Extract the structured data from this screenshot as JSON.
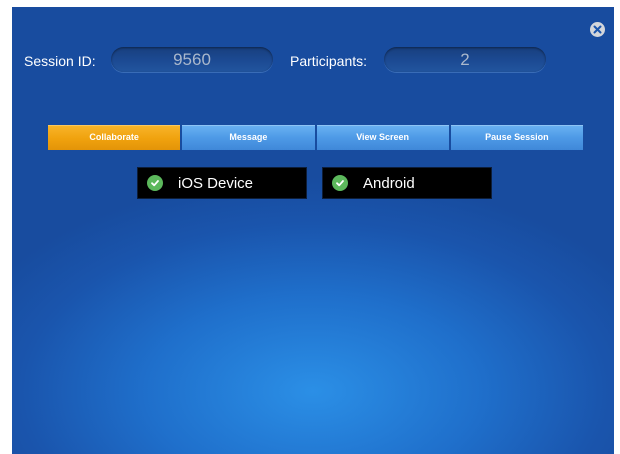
{
  "header": {
    "session_label": "Session ID:",
    "session_id": "9560",
    "participants_label": "Participants:",
    "participants_count": "2"
  },
  "tabs": [
    {
      "label": "Collaborate",
      "active": true
    },
    {
      "label": "Message",
      "active": false
    },
    {
      "label": "View Screen",
      "active": false
    },
    {
      "label": "Pause Session",
      "active": false
    }
  ],
  "devices": [
    {
      "name": "iOS Device",
      "status_icon": "check-circle-icon"
    },
    {
      "name": "Android",
      "status_icon": "check-circle-icon"
    }
  ],
  "colors": {
    "accent_active_tab": "#f0a20e",
    "tab": "#4e9ae6",
    "background": "#1f6fcb",
    "status_ok": "#5cb85c"
  },
  "icons": {
    "close": "close-icon"
  }
}
